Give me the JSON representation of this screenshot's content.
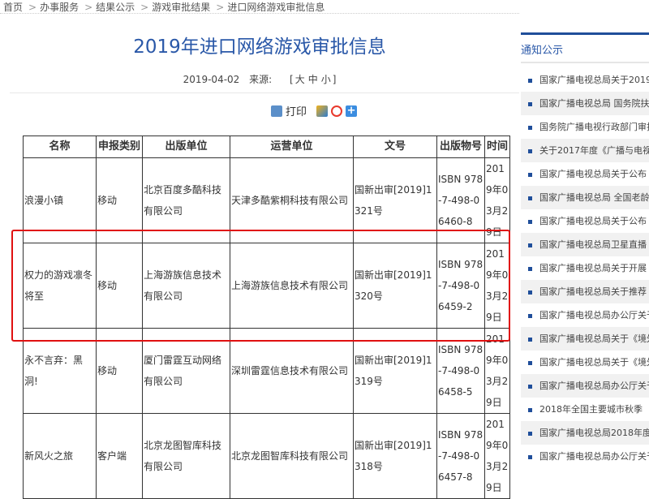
{
  "breadcrumb": [
    "首页",
    "办事服务",
    "结果公示",
    "游戏审批结果",
    "进口网络游戏审批信息"
  ],
  "title": "2019年进口网络游戏审批信息",
  "meta": {
    "date": "2019-04-02",
    "source_label": "来源:",
    "size_open": "[",
    "size_large": "大",
    "size_medium": "中",
    "size_small": "小",
    "size_close": "]"
  },
  "tools": {
    "print": "打印"
  },
  "table": {
    "headers": [
      "名称",
      "申报类别",
      "出版单位",
      "运营单位",
      "文号",
      "出版物号",
      "时间"
    ],
    "rows": [
      [
        "浪漫小镇",
        "移动",
        "北京百度多酷科技有限公司",
        "天津多酷紫桐科技有限公司",
        "国新出审[2019]1321号",
        "ISBN 978-7-498-06460-8",
        "2019年03月29日"
      ],
      [
        "权力的游戏凛冬将至",
        "移动",
        "上海游族信息技术有限公司",
        "上海游族信息技术有限公司",
        "国新出审[2019]1320号",
        "ISBN 978-7-498-06459-2",
        "2019年03月29日"
      ],
      [
        "永不言弃：黑洞!",
        "移动",
        "厦门雷霆互动网络有限公司",
        "深圳雷霆信息技术有限公司",
        "国新出审[2019]1319号",
        "ISBN 978-7-498-06458-5",
        "2019年03月29日"
      ],
      [
        "新风火之旅",
        "客户端",
        "北京龙图智库科技有限公司",
        "北京龙图智库科技有限公司",
        "国新出审[2019]1318号",
        "ISBN 978-7-498-06457-8",
        "2019年03月29日"
      ]
    ]
  },
  "sidebar": {
    "title": "通知公示",
    "items": [
      "国家广播电视总局关于2019",
      "国家广播电视总局 国务院扶贫",
      "国务院广播电视行政部门审批",
      "关于2017年度《广播与电视",
      "国家广播电视总局关于公布",
      "国家广播电视总局 全国老龄",
      "国家广播电视总局关于公布",
      "国家广播电视总局卫星直播",
      "国家广播电视总局关于开展",
      "国家广播电视总局关于推荐",
      "国家广播电视总局办公厅关于",
      "国家广播电视总局关于《境外",
      "国家广播电视总局关于《境外",
      "国家广播电视总局办公厅关于",
      "2018年全国主要城市秋季",
      "国家广播电视总局2018年度",
      "国家广播电视总局办公厅关于"
    ]
  },
  "colors": {
    "accent": "#2a58a8",
    "highlight": "#e01010"
  }
}
